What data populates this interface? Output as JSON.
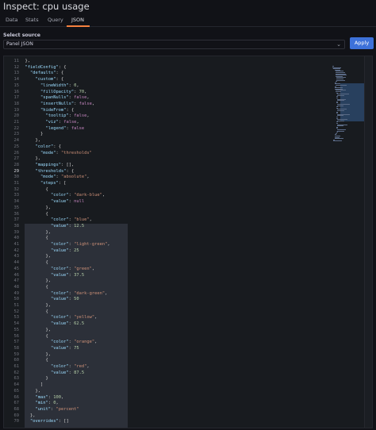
{
  "header": {
    "title": "Inspect: cpu usage"
  },
  "tabs": [
    {
      "label": "Data"
    },
    {
      "label": "Stats"
    },
    {
      "label": "Query"
    },
    {
      "label": "JSON",
      "active": true
    }
  ],
  "source": {
    "label": "Select source",
    "value": "Panel JSON"
  },
  "apply_button": {
    "label": "Apply"
  },
  "colors": {
    "accent": "#3d71d9",
    "tab_underline": "#f5813f",
    "background": "#111217",
    "editor_bg": "#181b1f"
  },
  "editor": {
    "current_line": 29,
    "lines": [
      {
        "n": "11",
        "t": "  },"
      },
      {
        "n": "12",
        "t": "  \"fieldConfig\": {"
      },
      {
        "n": "13",
        "t": "    \"defaults\": {"
      },
      {
        "n": "14",
        "t": "      \"custom\": {"
      },
      {
        "n": "15",
        "t": "        \"lineWidth\": 0,"
      },
      {
        "n": "16",
        "t": "        \"fillOpacity\": 70,"
      },
      {
        "n": "17",
        "t": "        \"spanNulls\": false,"
      },
      {
        "n": "18",
        "t": "        \"insertNulls\": false,"
      },
      {
        "n": "19",
        "t": "        \"hideFrom\": {"
      },
      {
        "n": "20",
        "t": "          \"tooltip\": false,"
      },
      {
        "n": "21",
        "t": "          \"viz\": false,"
      },
      {
        "n": "22",
        "t": "          \"legend\": false"
      },
      {
        "n": "23",
        "t": "        }"
      },
      {
        "n": "24",
        "t": "      },"
      },
      {
        "n": "25",
        "t": "      \"color\": {"
      },
      {
        "n": "26",
        "t": "        \"mode\": \"thresholds\""
      },
      {
        "n": "27",
        "t": "      },"
      },
      {
        "n": "28",
        "t": "      \"mappings\": [],"
      },
      {
        "n": "29",
        "t": "      \"thresholds\": {"
      },
      {
        "n": "30",
        "t": "        \"mode\": \"absolute\","
      },
      {
        "n": "31",
        "t": "        \"steps\": ["
      },
      {
        "n": "32",
        "t": "          {"
      },
      {
        "n": "33",
        "t": "            \"color\": \"dark-blue\","
      },
      {
        "n": "34",
        "t": "            \"value\": null"
      },
      {
        "n": "35",
        "t": "          },"
      },
      {
        "n": "36",
        "t": "          {"
      },
      {
        "n": "37",
        "t": "            \"color\": \"blue\","
      },
      {
        "n": "38",
        "t": "            \"value\": 12.5"
      },
      {
        "n": "39",
        "t": "          },"
      },
      {
        "n": "40",
        "t": "          {"
      },
      {
        "n": "41",
        "t": "            \"color\": \"light-green\","
      },
      {
        "n": "42",
        "t": "            \"value\": 25"
      },
      {
        "n": "43",
        "t": "          },"
      },
      {
        "n": "44",
        "t": "          {"
      },
      {
        "n": "45",
        "t": "            \"color\": \"green\","
      },
      {
        "n": "46",
        "t": "            \"value\": 37.5"
      },
      {
        "n": "47",
        "t": "          },"
      },
      {
        "n": "48",
        "t": "          {"
      },
      {
        "n": "49",
        "t": "            \"color\": \"dark-green\","
      },
      {
        "n": "50",
        "t": "            \"value\": 50"
      },
      {
        "n": "51",
        "t": "          },"
      },
      {
        "n": "52",
        "t": "          {"
      },
      {
        "n": "53",
        "t": "            \"color\": \"yellow\","
      },
      {
        "n": "54",
        "t": "            \"value\": 62.5"
      },
      {
        "n": "55",
        "t": "          },"
      },
      {
        "n": "56",
        "t": "          {"
      },
      {
        "n": "57",
        "t": "            \"color\": \"orange\","
      },
      {
        "n": "58",
        "t": "            \"value\": 75"
      },
      {
        "n": "59",
        "t": "          },"
      },
      {
        "n": "60",
        "t": "          {"
      },
      {
        "n": "61",
        "t": "            \"color\": \"red\","
      },
      {
        "n": "62",
        "t": "            \"value\": 87.5"
      },
      {
        "n": "63",
        "t": "          }"
      },
      {
        "n": "64",
        "t": "        ]"
      },
      {
        "n": "65",
        "t": "      },"
      },
      {
        "n": "66",
        "t": "      \"max\": 100,"
      },
      {
        "n": "67",
        "t": "      \"min\": 0,"
      },
      {
        "n": "68",
        "t": "      \"unit\": \"percent\""
      },
      {
        "n": "69",
        "t": "    },"
      },
      {
        "n": "70",
        "t": "    \"overrides\": []"
      }
    ]
  }
}
